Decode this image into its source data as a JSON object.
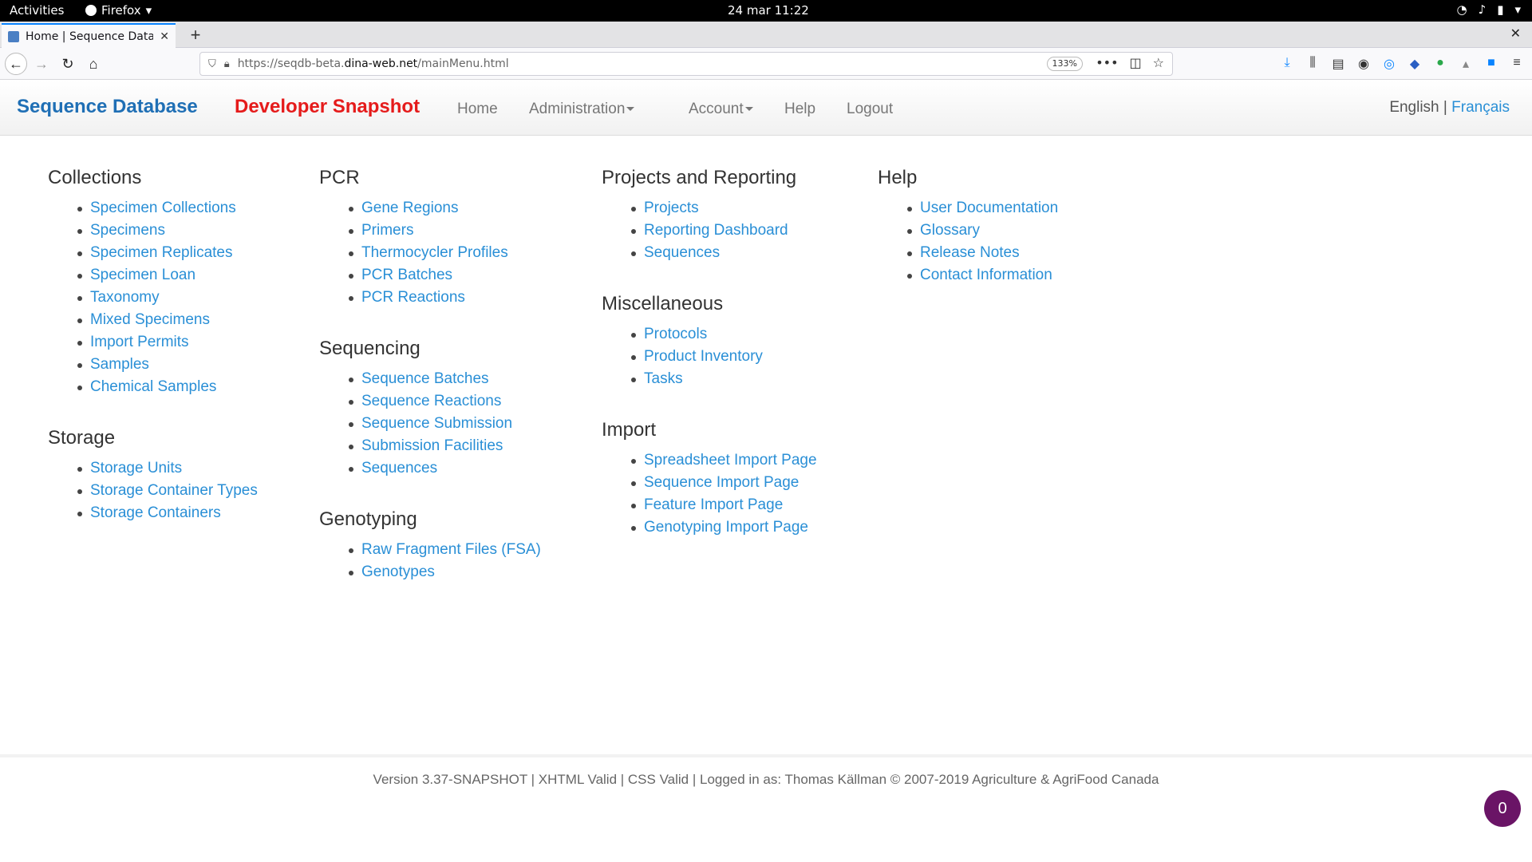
{
  "os_bar": {
    "activities": "Activities",
    "app_name": "Firefox",
    "clock": "24 mar  11:22"
  },
  "browser": {
    "tab_title": "Home | Sequence Databa",
    "url_prefix": "https://seqdb-beta.",
    "url_domain": "dina-web.net",
    "url_path": "/mainMenu.html",
    "zoom": "133%"
  },
  "site": {
    "brand": "Sequence Database",
    "snapshot": "Developer Snapshot",
    "nav": {
      "home": "Home",
      "administration": "Administration",
      "account": "Account",
      "help": "Help",
      "logout": "Logout"
    },
    "lang_current": "English",
    "lang_sep": "|",
    "lang_other": "Français"
  },
  "sections": {
    "collections": {
      "title": "Collections",
      "items": [
        "Specimen Collections",
        "Specimens",
        "Specimen Replicates",
        "Specimen Loan",
        "Taxonomy",
        "Mixed Specimens",
        "Import Permits",
        "Samples",
        "Chemical Samples"
      ]
    },
    "storage": {
      "title": "Storage",
      "items": [
        "Storage Units",
        "Storage Container Types",
        "Storage Containers"
      ]
    },
    "pcr": {
      "title": "PCR",
      "items": [
        "Gene Regions",
        "Primers",
        "Thermocycler Profiles",
        "PCR Batches",
        "PCR Reactions"
      ]
    },
    "sequencing": {
      "title": "Sequencing",
      "items": [
        "Sequence Batches",
        "Sequence Reactions",
        "Sequence Submission",
        "Submission Facilities",
        "Sequences"
      ]
    },
    "genotyping": {
      "title": "Genotyping",
      "items": [
        "Raw Fragment Files (FSA)",
        "Genotypes"
      ]
    },
    "projects": {
      "title": "Projects and Reporting",
      "items": [
        "Projects",
        "Reporting Dashboard",
        "Sequences"
      ]
    },
    "misc": {
      "title": "Miscellaneous",
      "items": [
        "Protocols",
        "Product Inventory",
        "Tasks"
      ]
    },
    "import": {
      "title": "Import",
      "items": [
        "Spreadsheet Import Page",
        "Sequence Import Page",
        "Feature Import Page",
        "Genotyping Import Page"
      ]
    },
    "help": {
      "title": "Help",
      "items": [
        "User Documentation",
        "Glossary",
        "Release Notes",
        "Contact Information"
      ]
    }
  },
  "footer": {
    "text": "Version 3.37-SNAPSHOT |  XHTML Valid |  CSS Valid | Logged in as: Thomas Källman © 2007-2019  Agriculture & AgriFood Canada"
  },
  "badge_count": "0",
  "colors": {
    "brand": "#1f6fb5",
    "snapshot": "#e51b1b",
    "link": "#2a8fd6",
    "badge": "#6a1466"
  }
}
